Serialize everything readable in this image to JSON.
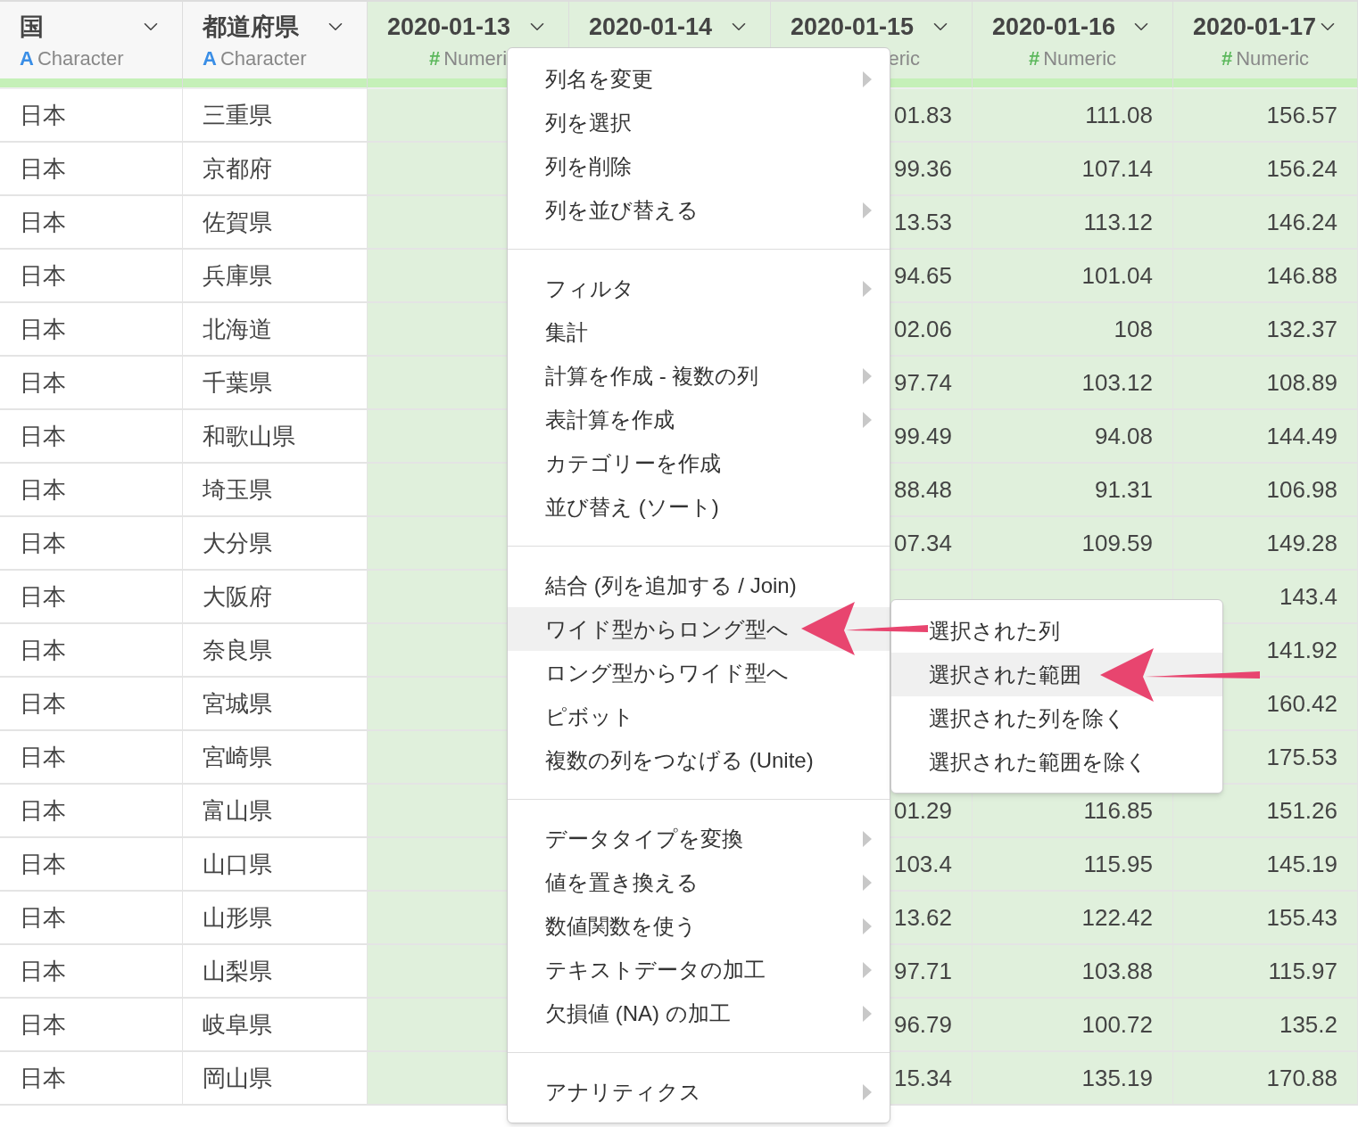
{
  "table": {
    "columns": [
      {
        "title": "国",
        "kind": "character",
        "type_icon": "A",
        "type": "Character"
      },
      {
        "title": "都道府県",
        "kind": "character",
        "type_icon": "A",
        "type": "Character"
      },
      {
        "title": "2020-01-13",
        "kind": "numeric",
        "type_icon": "#",
        "type": "Numeri"
      },
      {
        "title": "2020-01-14",
        "kind": "numeric"
      },
      {
        "title": "2020-01-15",
        "kind": "numeric",
        "type": "eric"
      },
      {
        "title": "2020-01-16",
        "kind": "numeric",
        "type_icon": "#",
        "type": "Numeric"
      },
      {
        "title": "2020-01-17",
        "kind": "numeric",
        "type_icon": "#",
        "type": "Numeric"
      }
    ],
    "rows": [
      [
        "日本",
        "三重県",
        null,
        null,
        "01.83",
        "111.08",
        "156.57"
      ],
      [
        "日本",
        "京都府",
        null,
        null,
        "99.36",
        "107.14",
        "156.24"
      ],
      [
        "日本",
        "佐賀県",
        null,
        null,
        "13.53",
        "113.12",
        "146.24"
      ],
      [
        "日本",
        "兵庫県",
        null,
        null,
        "94.65",
        "101.04",
        "146.88"
      ],
      [
        "日本",
        "北海道",
        null,
        null,
        "02.06",
        "108",
        "132.37"
      ],
      [
        "日本",
        "千葉県",
        null,
        null,
        "97.74",
        "103.12",
        "108.89"
      ],
      [
        "日本",
        "和歌山県",
        null,
        null,
        "99.49",
        "94.08",
        "144.49"
      ],
      [
        "日本",
        "埼玉県",
        null,
        null,
        "88.48",
        "91.31",
        "106.98"
      ],
      [
        "日本",
        "大分県",
        null,
        null,
        "07.34",
        "109.59",
        "149.28"
      ],
      [
        "日本",
        "大阪府",
        null,
        null,
        null,
        null,
        "143.4"
      ],
      [
        "日本",
        "奈良県",
        null,
        null,
        null,
        null,
        "141.92"
      ],
      [
        "日本",
        "宮城県",
        null,
        null,
        null,
        null,
        "160.42"
      ],
      [
        "日本",
        "宮崎県",
        null,
        null,
        null,
        null,
        "175.53"
      ],
      [
        "日本",
        "富山県",
        null,
        null,
        "01.29",
        "116.85",
        "151.26"
      ],
      [
        "日本",
        "山口県",
        null,
        null,
        "103.4",
        "115.95",
        "145.19"
      ],
      [
        "日本",
        "山形県",
        null,
        null,
        "13.62",
        "122.42",
        "155.43"
      ],
      [
        "日本",
        "山梨県",
        null,
        null,
        "97.71",
        "103.88",
        "115.97"
      ],
      [
        "日本",
        "岐阜県",
        null,
        null,
        "96.79",
        "100.72",
        "135.2"
      ],
      [
        "日本",
        "岡山県",
        null,
        null,
        "15.34",
        "135.19",
        "170.88"
      ]
    ]
  },
  "context_menu": {
    "sections": [
      [
        {
          "label": "列名を変更",
          "has_submenu": true,
          "selected": false
        },
        {
          "label": "列を選択",
          "has_submenu": false,
          "selected": false
        },
        {
          "label": "列を削除",
          "has_submenu": false,
          "selected": false
        },
        {
          "label": "列を並び替える",
          "has_submenu": true,
          "selected": false
        }
      ],
      [
        {
          "label": "フィルタ",
          "has_submenu": true,
          "selected": false
        },
        {
          "label": "集計",
          "has_submenu": false,
          "selected": false
        },
        {
          "label": "計算を作成 - 複数の列",
          "has_submenu": true,
          "selected": false
        },
        {
          "label": "表計算を作成",
          "has_submenu": true,
          "selected": false
        },
        {
          "label": "カテゴリーを作成",
          "has_submenu": false,
          "selected": false
        },
        {
          "label": "並び替え (ソート)",
          "has_submenu": false,
          "selected": false
        }
      ],
      [
        {
          "label": "結合 (列を追加する / Join)",
          "has_submenu": false,
          "selected": false
        },
        {
          "label": "ワイド型からロング型へ",
          "has_submenu": false,
          "selected": true
        },
        {
          "label": "ロング型からワイド型へ",
          "has_submenu": false,
          "selected": false
        },
        {
          "label": "ピボット",
          "has_submenu": false,
          "selected": false
        },
        {
          "label": "複数の列をつなげる (Unite)",
          "has_submenu": false,
          "selected": false
        }
      ],
      [
        {
          "label": "データタイプを変換",
          "has_submenu": true,
          "selected": false
        },
        {
          "label": "値を置き換える",
          "has_submenu": true,
          "selected": false
        },
        {
          "label": "数値関数を使う",
          "has_submenu": true,
          "selected": false
        },
        {
          "label": "テキストデータの加工",
          "has_submenu": true,
          "selected": false
        },
        {
          "label": "欠損値 (NA) の加工",
          "has_submenu": true,
          "selected": false
        }
      ],
      [
        {
          "label": "アナリティクス",
          "has_submenu": true,
          "selected": false
        }
      ]
    ]
  },
  "submenu": {
    "items": [
      {
        "label": "選択された列",
        "selected": false
      },
      {
        "label": "選択された範囲",
        "selected": true
      },
      {
        "label": "選択された列を除く",
        "selected": false
      },
      {
        "label": "選択された範囲を除く",
        "selected": false
      }
    ]
  }
}
